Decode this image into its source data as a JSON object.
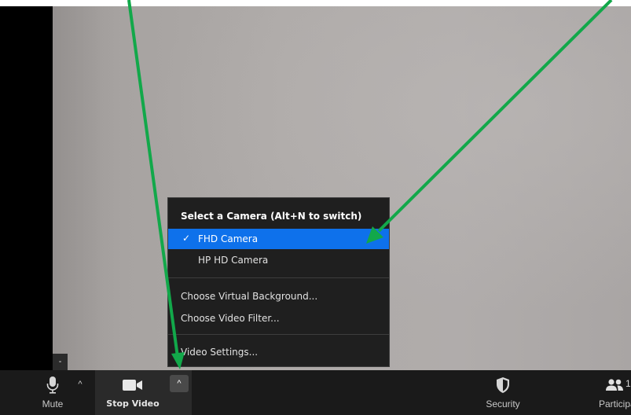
{
  "camera_menu": {
    "header": "Select a Camera (Alt+N to switch)",
    "items": [
      {
        "label": "FHD Camera",
        "selected": true
      },
      {
        "label": "HP HD Camera",
        "selected": false
      }
    ],
    "checkmark": "✓",
    "virtual_background": "Choose Virtual Background...",
    "video_filter": "Choose Video Filter...",
    "video_settings": "Video Settings..."
  },
  "toolbar": {
    "mute_label": "Mute",
    "mute_icon": "microphone-icon",
    "stop_video_label": "Stop Video",
    "video_icon": "video-camera-icon",
    "caret": "^",
    "security_label": "Security",
    "security_icon": "shield-icon",
    "participants_label": "Participants",
    "participants_icon": "people-icon",
    "participants_count": "1"
  },
  "collapse_tab": "-",
  "colors": {
    "menu_bg": "#1f1f1f",
    "selected_bg": "#0e71eb",
    "toolbar_bg": "#1a1a1a",
    "annotation_arrow": "#12a84a"
  }
}
